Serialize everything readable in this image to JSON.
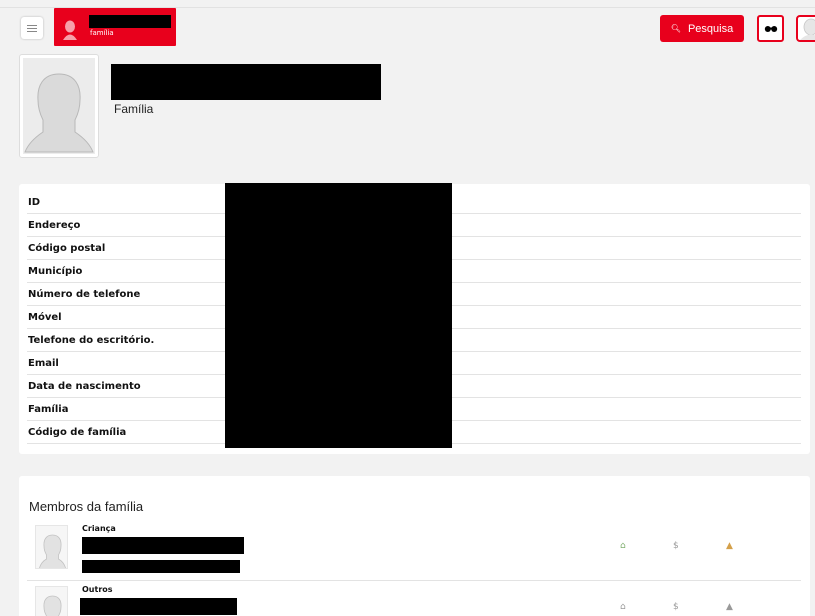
{
  "header": {
    "brand_subtitle": "família",
    "search_label": "Pesquisa",
    "icons": [
      "menu-icon",
      "avatar-icon",
      "search-icon",
      "mask-icon",
      "user-avatar-icon"
    ],
    "accent_color": "#e8001c"
  },
  "profile": {
    "type_label": "Família"
  },
  "info": {
    "rows": [
      {
        "label": "ID"
      },
      {
        "label": "Endereço"
      },
      {
        "label": "Código postal"
      },
      {
        "label": "Município"
      },
      {
        "label": "Número de telefone"
      },
      {
        "label": "Móvel"
      },
      {
        "label": "Telefone do escritório."
      },
      {
        "label": "Email"
      },
      {
        "label": "Data de nascimento"
      },
      {
        "label": "Família"
      },
      {
        "label": "Código de família"
      }
    ]
  },
  "members": {
    "title": "Membros da família",
    "items": [
      {
        "role": "Criança"
      },
      {
        "role": "Outros"
      }
    ]
  }
}
